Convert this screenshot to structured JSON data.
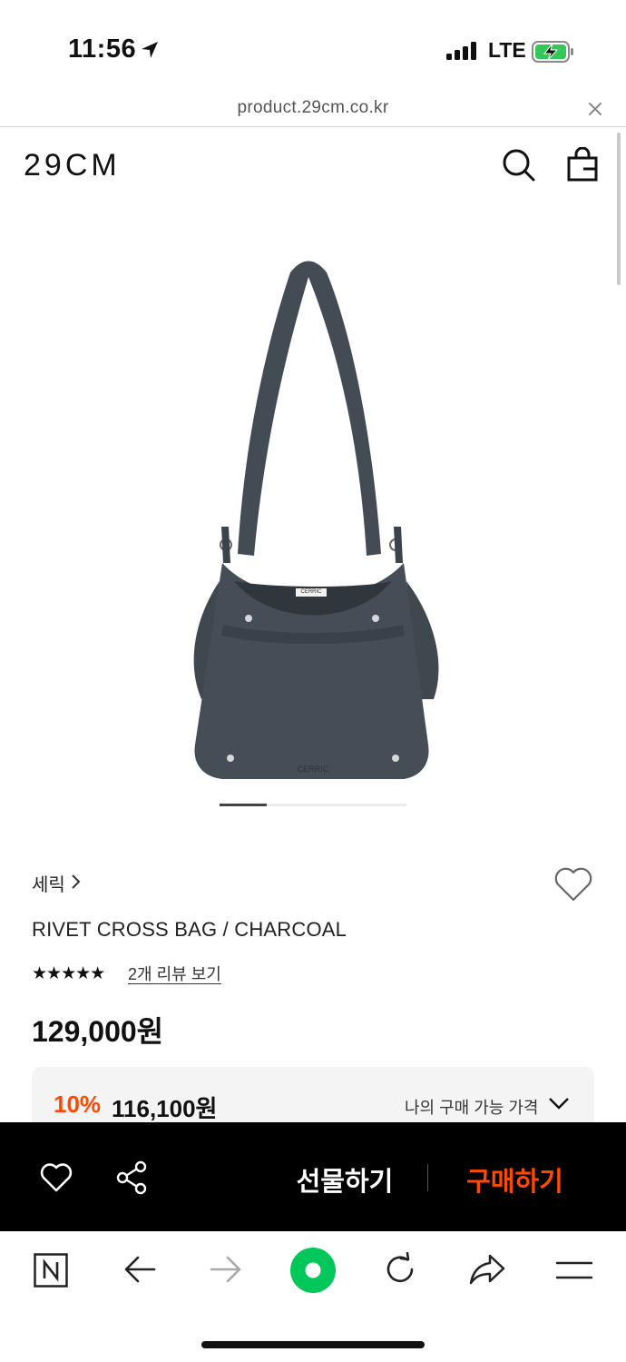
{
  "status_bar": {
    "time": "11:56",
    "network": "LTE",
    "icons": [
      "location-arrow-icon",
      "signal-icon",
      "battery-charging-icon"
    ]
  },
  "browser": {
    "url": "product.29cm.co.kr"
  },
  "header": {
    "logo": "29CM",
    "icons": [
      "search-icon",
      "shopping-bag-icon"
    ]
  },
  "product": {
    "brand": "세릭",
    "brand_chevron": "›",
    "name": "RIVET CROSS BAG / CHARCOAL",
    "rating_stars": "★★★★★",
    "rating": 5,
    "review_link": "2개 리뷰 보기",
    "price": "129,000원",
    "image_label_tag": "CERRIC",
    "image_label_emboss": "CERRIC",
    "carousel": {
      "current": 1,
      "total": 4
    }
  },
  "promo": {
    "discount_rate": "10%",
    "discount_price": "116,100원",
    "label": "나의 구매 가능 가격"
  },
  "purchase_bar": {
    "gift_label": "선물하기",
    "buy_label": "구매하기",
    "icons": [
      "heart-icon",
      "share-icon"
    ]
  },
  "toolbar": {
    "icons": [
      "naver-icon",
      "back-arrow-icon",
      "forward-arrow-icon",
      "green-dot-icon",
      "reload-icon",
      "share-arrow-icon",
      "menu-icon"
    ]
  },
  "colors": {
    "accent": "#ff4800",
    "bag": "#414a52",
    "green_button": "#03c75a"
  }
}
